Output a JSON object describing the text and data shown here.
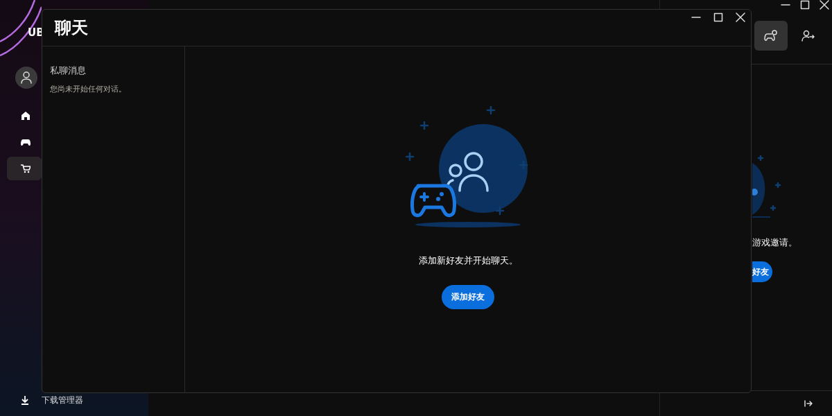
{
  "background_app": {
    "logo": "UB",
    "sidebar": {
      "items": [
        {
          "kind": "home",
          "selected": false
        },
        {
          "kind": "games",
          "selected": false
        },
        {
          "kind": "store",
          "selected": true
        }
      ],
      "download_manager": "下载管理器"
    },
    "right_panel": {
      "tabs": [
        {
          "kind": "game-invites",
          "selected": true
        },
        {
          "kind": "friend-requests",
          "selected": false
        }
      ],
      "message": "游戏邀请。",
      "button": "好友"
    }
  },
  "chat_window": {
    "title": "聊天",
    "private_messages": {
      "heading": "私聊消息",
      "empty_text": "您尚未开始任何对话。"
    },
    "empty_state": {
      "message": "添加新好友并开始聊天。",
      "button": "添加好友"
    }
  }
}
